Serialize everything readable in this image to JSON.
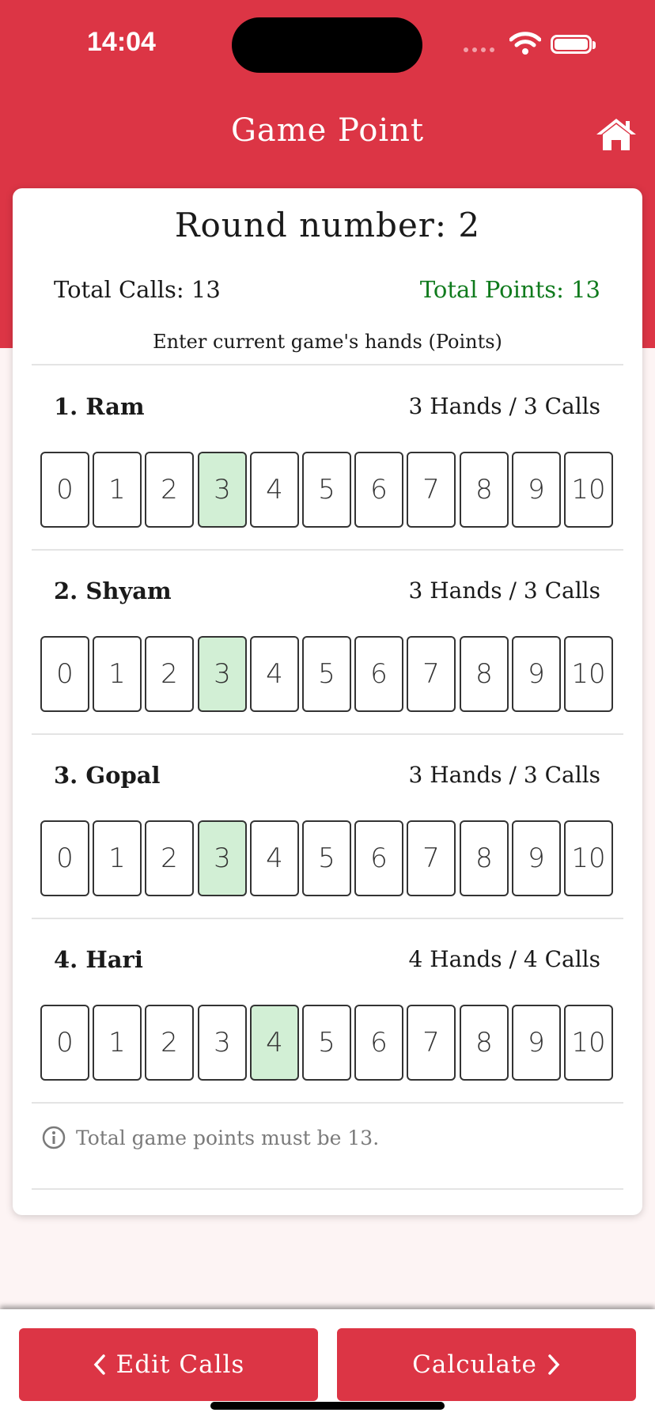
{
  "status_bar": {
    "time": "14:04"
  },
  "header": {
    "title": "Game Point",
    "home_icon": "home-icon"
  },
  "round": {
    "title": "Round number: 2",
    "total_calls": "Total Calls: 13",
    "total_points": "Total Points: 13",
    "instruction": "Enter current game's hands (Points)"
  },
  "colors": {
    "brand": "#dc3545",
    "points_green": "#0f7a1c",
    "selected_bg": "#d2efd5"
  },
  "hand_options": [
    "0",
    "1",
    "2",
    "3",
    "4",
    "5",
    "6",
    "7",
    "8",
    "9",
    "10"
  ],
  "players": [
    {
      "name": "1. Ram",
      "summary": "3 Hands / 3 Calls",
      "selected": 3
    },
    {
      "name": "2. Shyam",
      "summary": "3 Hands / 3 Calls",
      "selected": 3
    },
    {
      "name": "3. Gopal",
      "summary": "3 Hands / 3 Calls",
      "selected": 3
    },
    {
      "name": "4. Hari",
      "summary": "4 Hands / 4 Calls",
      "selected": 4
    }
  ],
  "info": {
    "icon": "info-icon",
    "text": "Total game points must be 13."
  },
  "buttons": {
    "edit_calls": "Edit Calls",
    "calculate": "Calculate"
  }
}
